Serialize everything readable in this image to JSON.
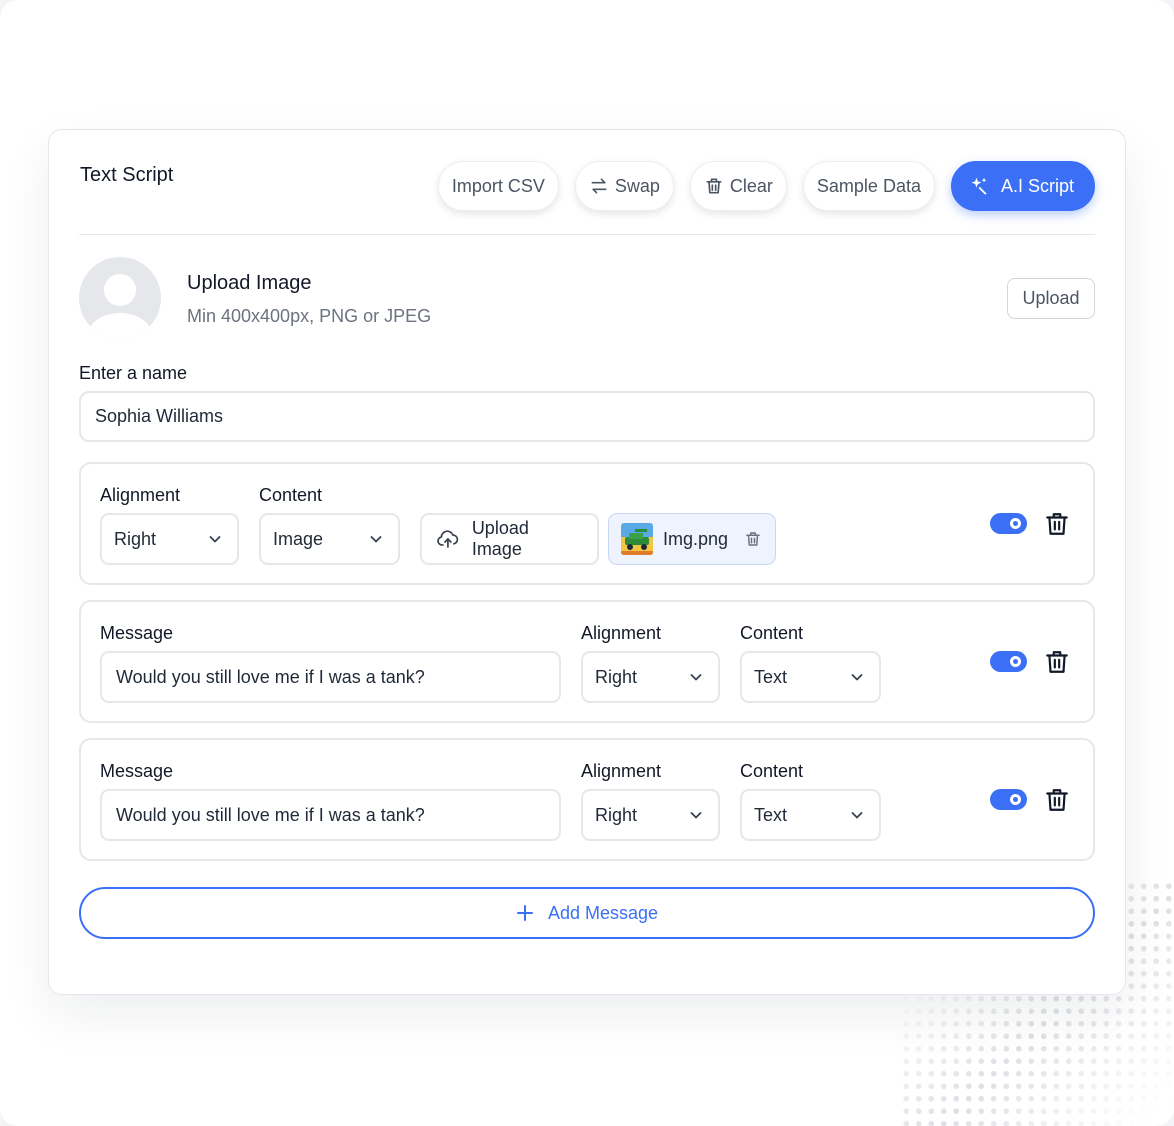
{
  "header": {
    "title": "Text Script",
    "toolbar": {
      "import_csv": "Import CSV",
      "swap": "Swap",
      "clear": "Clear",
      "sample_data": "Sample Data",
      "ai_script": "A.I Script"
    }
  },
  "upload": {
    "title": "Upload Image",
    "subtitle": "Min 400x400px, PNG or JPEG",
    "button": "Upload"
  },
  "name": {
    "label": "Enter a name",
    "value": "Sophia Williams"
  },
  "image_row": {
    "alignment_label": "Alignment",
    "alignment_value": "Right",
    "content_label": "Content",
    "content_value": "Image",
    "upload_button": "Upload Image",
    "file_name": "Img.png",
    "enabled": true
  },
  "messages": [
    {
      "message_label": "Message",
      "message_value": "Would you still love me if I was a tank?",
      "alignment_label": "Alignment",
      "alignment_value": "Right",
      "content_label": "Content",
      "content_value": "Text",
      "enabled": true
    },
    {
      "message_label": "Message",
      "message_value": "Would you still love me if I was a tank?",
      "alignment_label": "Alignment",
      "alignment_value": "Right",
      "content_label": "Content",
      "content_value": "Text",
      "enabled": true
    }
  ],
  "add_message": "Add Message",
  "icons": {
    "swap": "swap-icon",
    "clear": "trash-icon",
    "ai": "magic-sparkle-icon",
    "upload_cloud": "cloud-upload-icon",
    "chevron": "chevron-down-icon",
    "delete": "trash-icon",
    "plus": "plus-icon"
  },
  "colors": {
    "accent": "#3b6ff5",
    "border": "#e5e7eb",
    "muted_text": "#6b7280"
  }
}
